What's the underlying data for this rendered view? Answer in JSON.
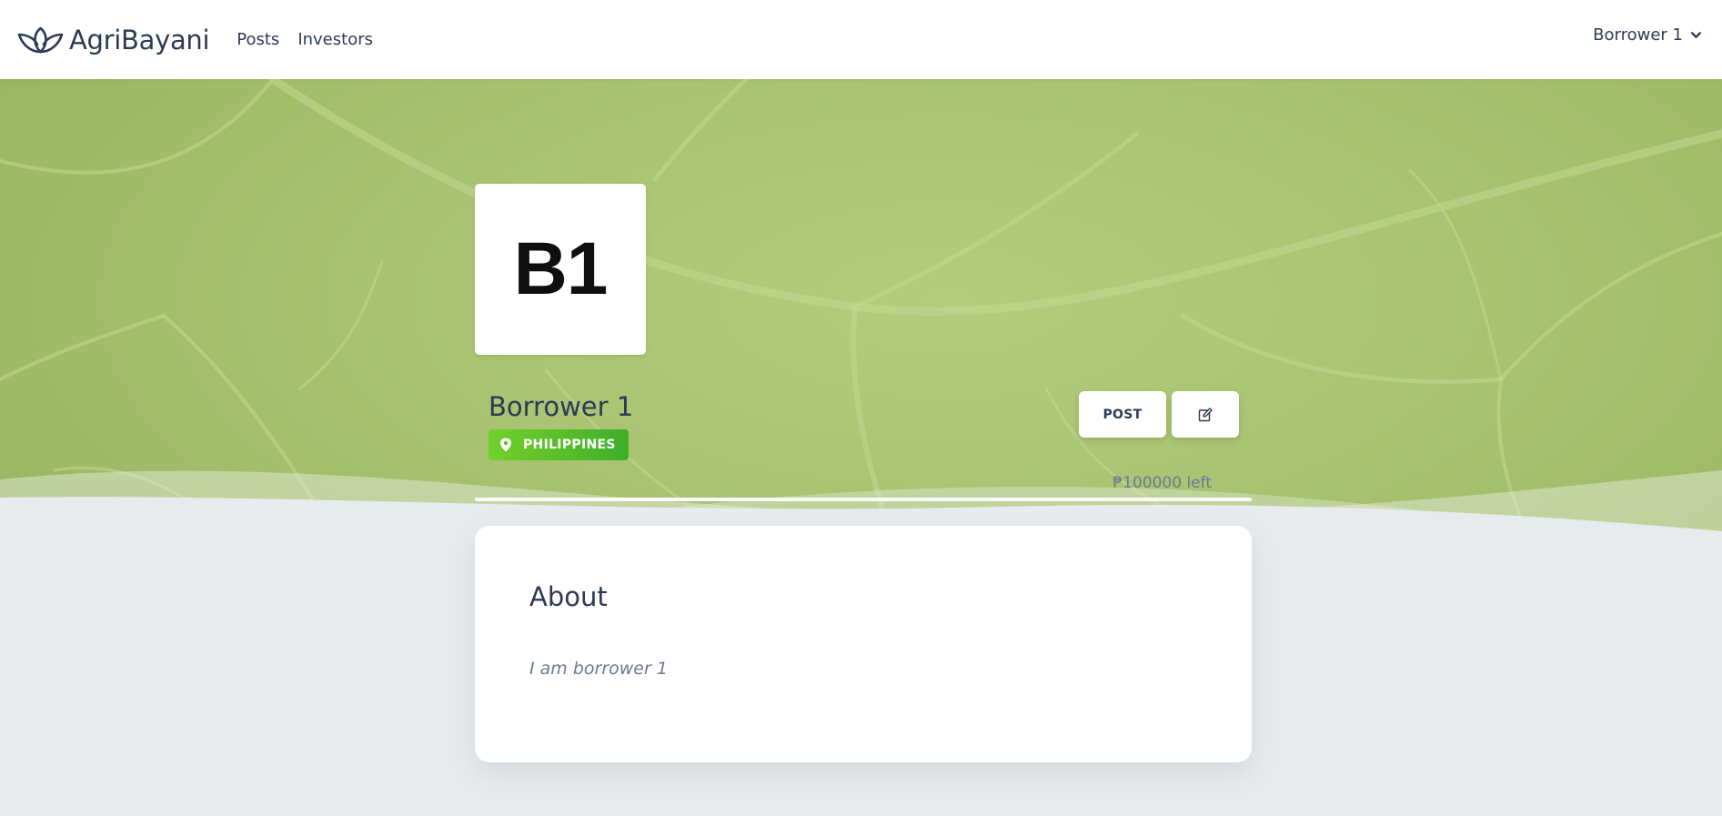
{
  "nav": {
    "brand": "AgriBayani",
    "links": [
      "Posts",
      "Investors"
    ],
    "user": "Borrower 1"
  },
  "profile": {
    "avatar_initials": "B1",
    "name": "Borrower 1",
    "location": "PHILIPPINES",
    "post_button": "POST",
    "funds_left": "₱100000 left"
  },
  "about": {
    "title": "About",
    "text": "I am borrower 1"
  },
  "colors": {
    "text_dark": "#2d3a55",
    "text_muted": "#6b7b95",
    "badge_green": "#5cc12a",
    "hero_green": "#a3bf6d",
    "page_bg": "#e8ebee"
  },
  "icons": [
    "leaf-logo-icon",
    "chevron-down-icon",
    "map-pin-icon",
    "edit-icon"
  ]
}
